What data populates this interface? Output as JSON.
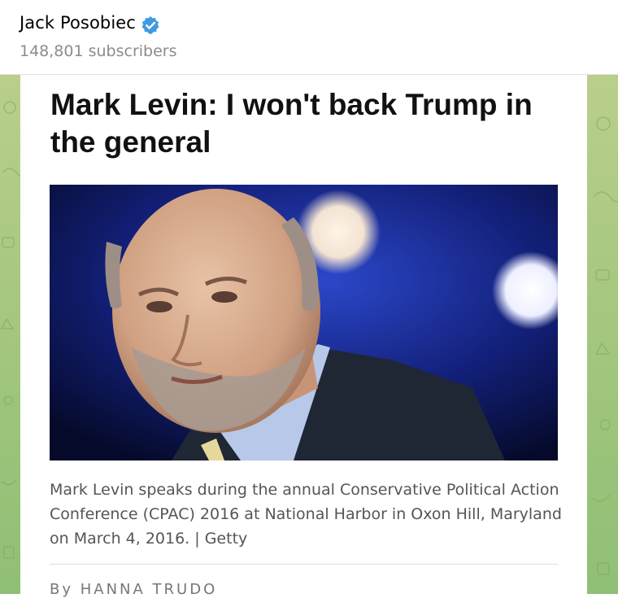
{
  "channel": {
    "name": "Jack Posobiec",
    "verified_icon": "verified-badge-icon",
    "subscribers": "148,801 subscribers"
  },
  "article": {
    "headline": "Mark Levin: I won't back Trump in the general",
    "photo_subject": "portrait-photo",
    "caption": "Mark Levin speaks during the annual Conservative Political Action Conference (CPAC) 2016 at National Harbor in Oxon Hill, Maryland on March 4, 2016.  | Getty",
    "byline": "By HANNA TRUDO"
  },
  "colors": {
    "verified": "#3e9be0",
    "chat_background": "#a6c77f",
    "headline": "#111111",
    "caption": "#555555"
  }
}
